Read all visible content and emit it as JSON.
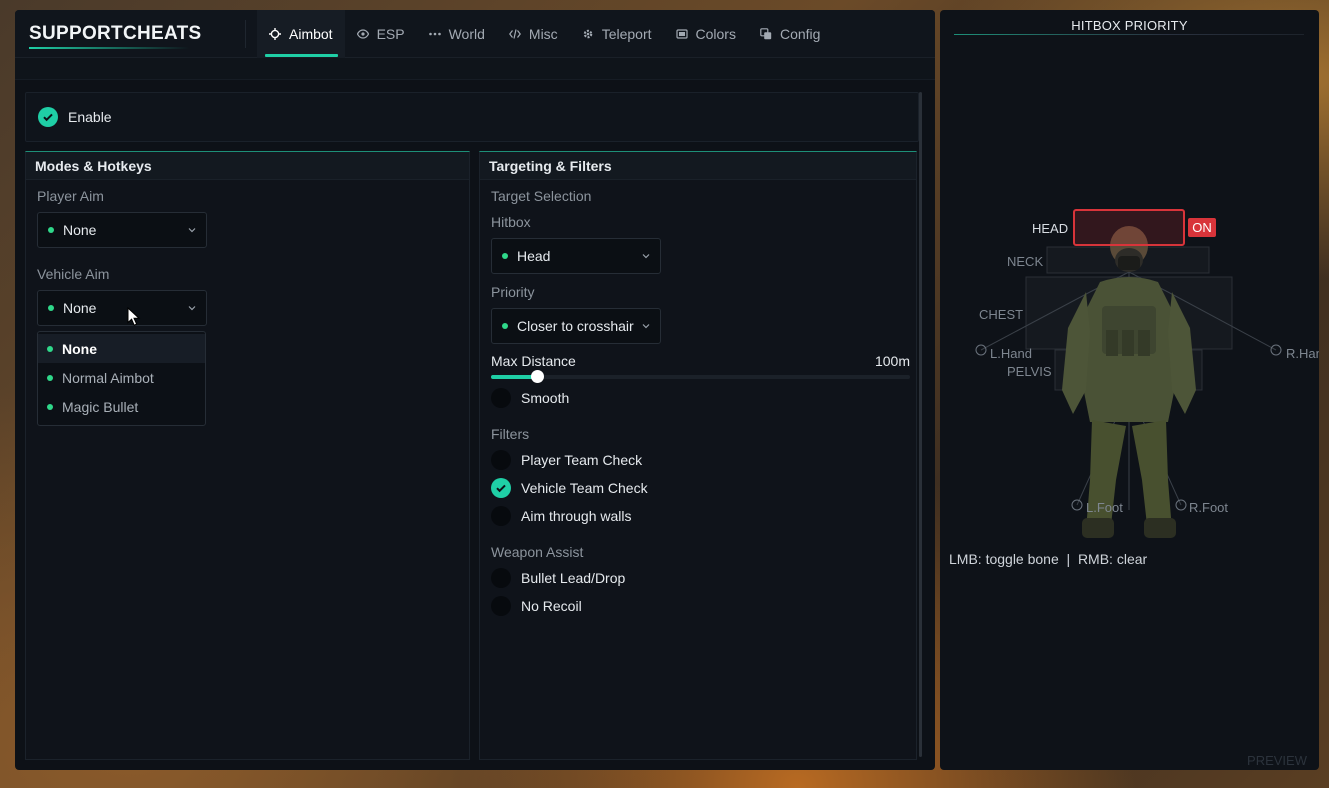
{
  "brand": "SUPPORTCHEATS",
  "tabs": [
    {
      "label": "Aimbot",
      "icon": "crosshair-icon",
      "active": true
    },
    {
      "label": "ESP",
      "icon": "eye-icon"
    },
    {
      "label": "World",
      "icon": "dots-icon"
    },
    {
      "label": "Misc",
      "icon": "code-icon"
    },
    {
      "label": "Teleport",
      "icon": "gear-icon"
    },
    {
      "label": "Colors",
      "icon": "palette-icon"
    },
    {
      "label": "Config",
      "icon": "copy-icon"
    }
  ],
  "enable": {
    "label": "Enable",
    "checked": true
  },
  "modes": {
    "title": "Modes & Hotkeys",
    "player_aim_label": "Player Aim",
    "player_aim_value": "None",
    "vehicle_aim_label": "Vehicle Aim",
    "vehicle_aim_value": "None",
    "vehicle_aim_options": [
      "None",
      "Normal Aimbot",
      "Magic Bullet"
    ]
  },
  "targeting": {
    "title": "Targeting & Filters",
    "target_selection_label": "Target Selection",
    "hitbox_label": "Hitbox",
    "hitbox_value": "Head",
    "priority_label": "Priority",
    "priority_value": "Closer to crosshair",
    "max_distance_label": "Max Distance",
    "max_distance_value": "100m",
    "max_distance_fraction": 0.11,
    "smooth": {
      "label": "Smooth",
      "checked": false
    },
    "filters_label": "Filters",
    "filters": [
      {
        "label": "Player Team Check",
        "checked": false
      },
      {
        "label": "Vehicle Team Check",
        "checked": true
      },
      {
        "label": "Aim through walls",
        "checked": false
      }
    ],
    "weapon_assist_label": "Weapon Assist",
    "weapon_assist": [
      {
        "label": "Bullet Lead/Drop",
        "checked": false
      },
      {
        "label": "No Recoil",
        "checked": false
      }
    ]
  },
  "hitbox_panel": {
    "title": "HITBOX PRIORITY",
    "bones": {
      "head": "HEAD",
      "neck": "NECK",
      "chest": "CHEST",
      "l_hand": "L.Hand",
      "r_hand": "R.Hand",
      "pelvis": "PELVIS",
      "l_foot": "L.Foot",
      "r_foot": "R.Foot"
    },
    "head_status": "ON",
    "hint": "LMB: toggle bone  |  RMB: clear",
    "preview_label": "PREVIEW"
  },
  "colors": {
    "accent": "#1fcfa6",
    "danger": "#d8343a",
    "dot": "#2fd88a"
  }
}
